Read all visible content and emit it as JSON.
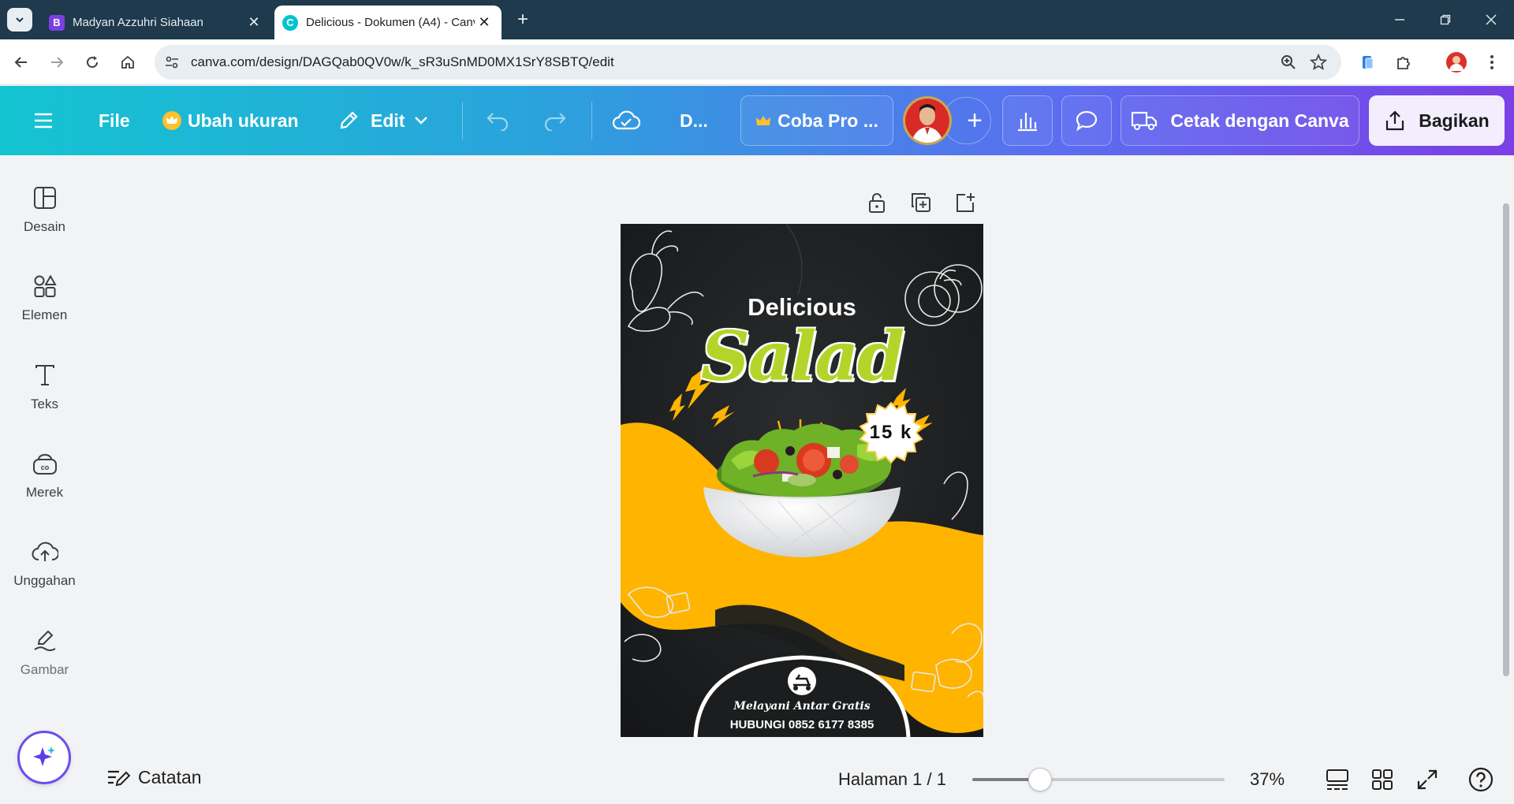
{
  "browser": {
    "tabs": [
      {
        "title": "Madyan Azzuhri Siahaan",
        "favicon": "B",
        "favicon_color": "#7b3fe4",
        "active": false
      },
      {
        "title": "Delicious - Dokumen (A4) - Canva",
        "favicon": "C",
        "favicon_color": "#00c4cc",
        "active": true
      }
    ],
    "url": "canva.com/design/DAGQab0QV0w/k_sR3uSnMD0MX1SrY8SBTQ/edit",
    "icons": {
      "menu": "chevron-down-icon",
      "back": "arrow-left-icon",
      "forward": "arrow-right-icon",
      "reload": "reload-icon",
      "home": "home-icon",
      "site_info": "tune-icon",
      "zoom": "zoom-in-icon",
      "bookmark": "star-icon",
      "extensions": "puzzle-icon",
      "more": "kebab-icon"
    }
  },
  "header": {
    "file": "File",
    "resize": "Ubah ukuran",
    "edit": "Edit",
    "doc_title": "D...",
    "pro": "Coba Pro ...",
    "print": "Cetak dengan Canva",
    "share": "Bagikan"
  },
  "sidebar": {
    "items": [
      {
        "label": "Desain",
        "icon": "layout-icon"
      },
      {
        "label": "Elemen",
        "icon": "shapes-icon"
      },
      {
        "label": "Teks",
        "icon": "text-icon"
      },
      {
        "label": "Merek",
        "icon": "brand-icon"
      },
      {
        "label": "Unggahan",
        "icon": "cloud-upload-icon"
      },
      {
        "label": "Gambar",
        "icon": "pen-draw-icon"
      }
    ]
  },
  "poster": {
    "title_top": "Delicious",
    "title_main": "Salad",
    "price": "15 k",
    "tagline": "Melayani Antar Gratis",
    "contact": "HUBUNGI 0852 6177 8385",
    "colors": {
      "background": "#1b1d1e",
      "wave": "#ffb400",
      "accent": "#b5d42a"
    }
  },
  "footer": {
    "notes": "Catatan",
    "page_indicator": "Halaman 1 / 1",
    "zoom_label": "37%",
    "zoom_value": 37
  }
}
